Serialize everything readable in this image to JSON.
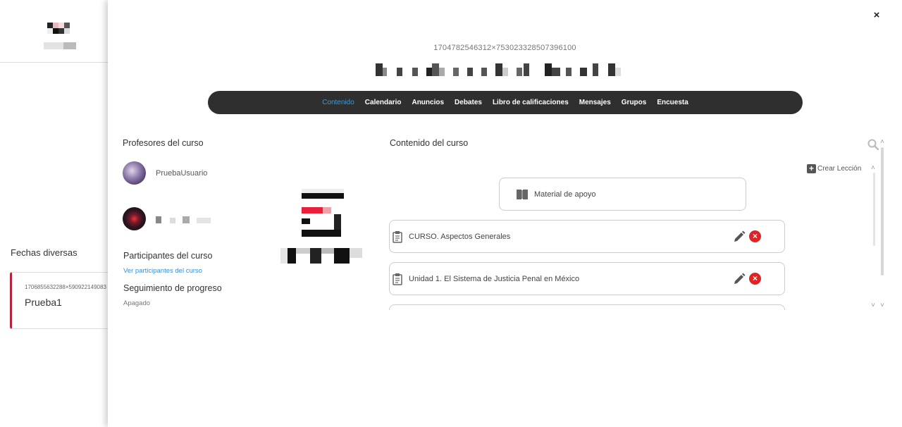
{
  "background": {
    "section_title": "Fechas diversas",
    "card": {
      "id": "1706855632288×590922149083",
      "title": "Prueba1"
    }
  },
  "modal": {
    "close": "×",
    "course_id": "1704782546312×753023328507396100",
    "nav": [
      "Contenido",
      "Calendario",
      "Anuncios",
      "Debates",
      "Libro de calificaciones",
      "Mensajes",
      "Grupos",
      "Encuesta"
    ],
    "nav_active": "Contenido",
    "teachers_title": "Profesores del curso",
    "teachers": [
      {
        "name": "PruebaUsuario"
      }
    ],
    "participants_title": "Participantes del curso",
    "participants_link": "Ver participantes del curso",
    "progress_title": "Seguimiento de progreso",
    "progress_status": "Apagado",
    "content_title": "Contenido del curso",
    "create_lesson": "Crear Lección",
    "support_material": "Material de apoyo",
    "lessons": [
      {
        "title": "CURSO. Aspectos Generales"
      },
      {
        "title": "Unidad 1. El Sistema de Justicia Penal en México"
      }
    ]
  },
  "colors": {
    "nav_bg": "#2f2f2f",
    "nav_active": "#3a9ad9",
    "link": "#3a8fd1",
    "delete": "#e02424",
    "card_accent": "#b5253a"
  }
}
